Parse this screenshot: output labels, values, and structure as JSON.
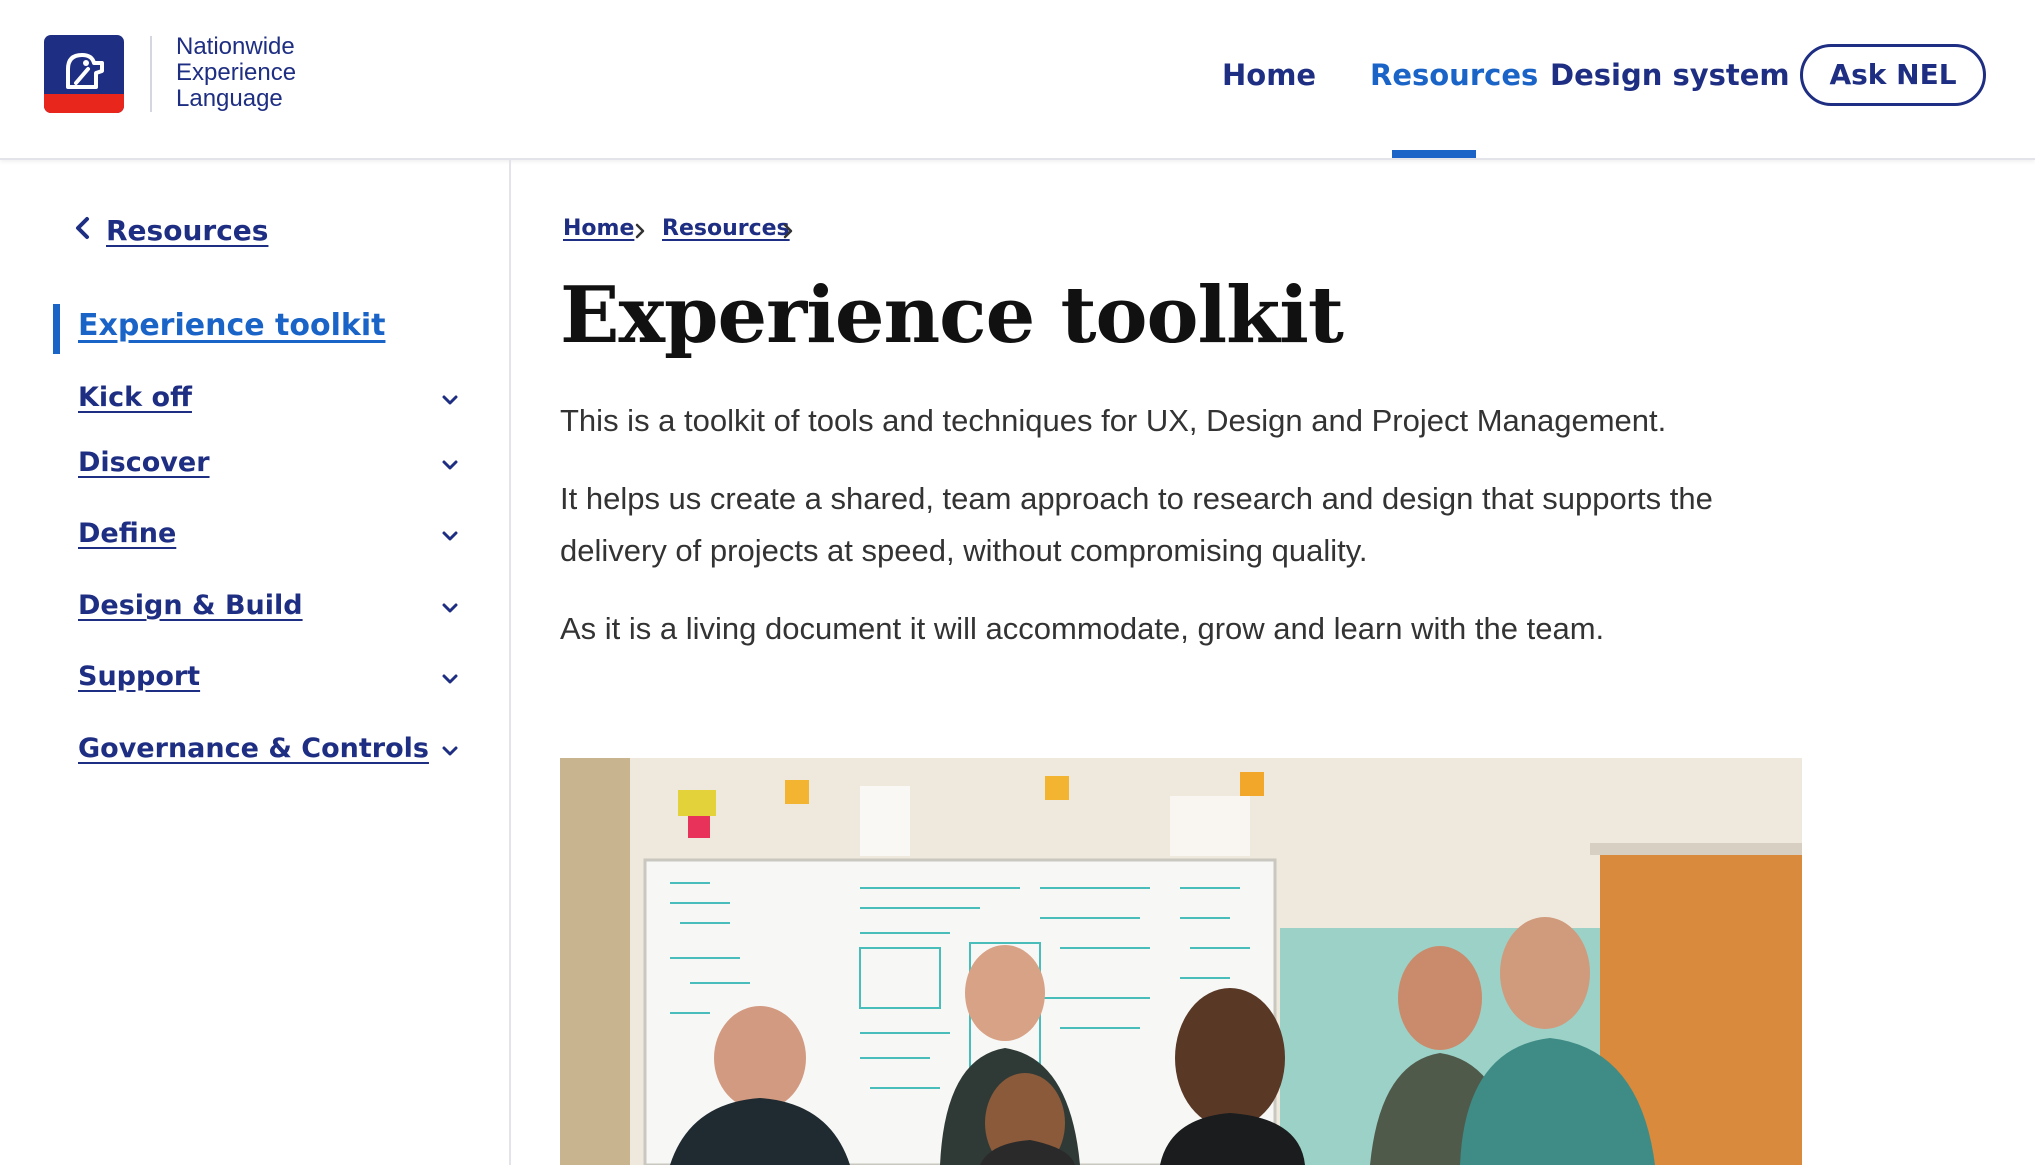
{
  "header": {
    "logo_lines": [
      "Nationwide",
      "Experience",
      "Language"
    ],
    "nav": [
      {
        "label": "Home",
        "active": false
      },
      {
        "label": "Resources",
        "active": true
      },
      {
        "label": "Design system",
        "active": false
      }
    ],
    "ask_button": "Ask NEL"
  },
  "sidebar": {
    "back_label": "Resources",
    "active_item": "Experience toolkit",
    "items": [
      {
        "label": "Kick off"
      },
      {
        "label": "Discover"
      },
      {
        "label": "Define"
      },
      {
        "label": "Design & Build"
      },
      {
        "label": "Support"
      },
      {
        "label": "Governance & Controls"
      }
    ]
  },
  "main": {
    "breadcrumb": [
      "Home",
      "Resources"
    ],
    "title": "Experience toolkit",
    "paragraphs": [
      "This is a toolkit of tools and techniques for UX, Design and Project Management.",
      "It helps us create a shared, team approach to research and design that supports the delivery of projects at speed, without compromising quality.",
      "As it is a living document it will accommodate, grow and learn with the team."
    ]
  },
  "colors": {
    "brand_navy": "#1e2e82",
    "accent_blue": "#1a64c8",
    "brand_red": "#e8261c"
  },
  "icons": [
    "nationwide-logo-icon",
    "chevron-left-icon",
    "chevron-down-icon",
    "chevron-right-icon"
  ]
}
